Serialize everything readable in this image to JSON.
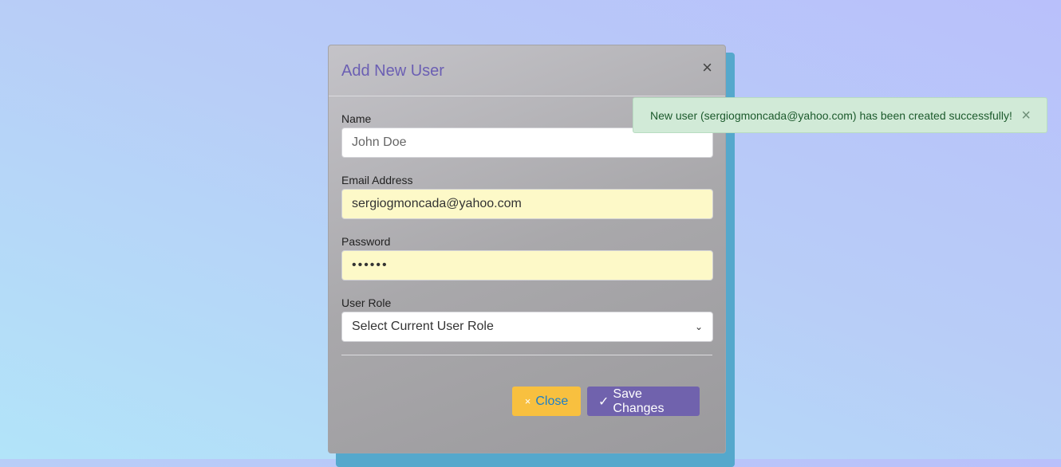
{
  "modal": {
    "title": "Add New User",
    "close_icon": "×",
    "fields": {
      "name": {
        "label": "Name",
        "placeholder": "John Doe"
      },
      "email": {
        "label": "Email Address",
        "value": "sergiogmoncada@yahoo.com"
      },
      "password": {
        "label": "Password",
        "value": "••••••"
      },
      "role": {
        "label": "User Role",
        "selected": "Select Current User Role"
      }
    },
    "buttons": {
      "close": {
        "icon": "×",
        "label": "Close"
      },
      "save": {
        "icon": "✓",
        "label": "Save Changes"
      }
    }
  },
  "toast": {
    "message": "New user (sergiogmoncada@yahoo.com) has been created successfully!",
    "close_icon": "×",
    "color": "#d1ead7"
  },
  "colors": {
    "accent": "#7062ad",
    "warning": "#f8c03f",
    "title": "#6b5fb3"
  }
}
